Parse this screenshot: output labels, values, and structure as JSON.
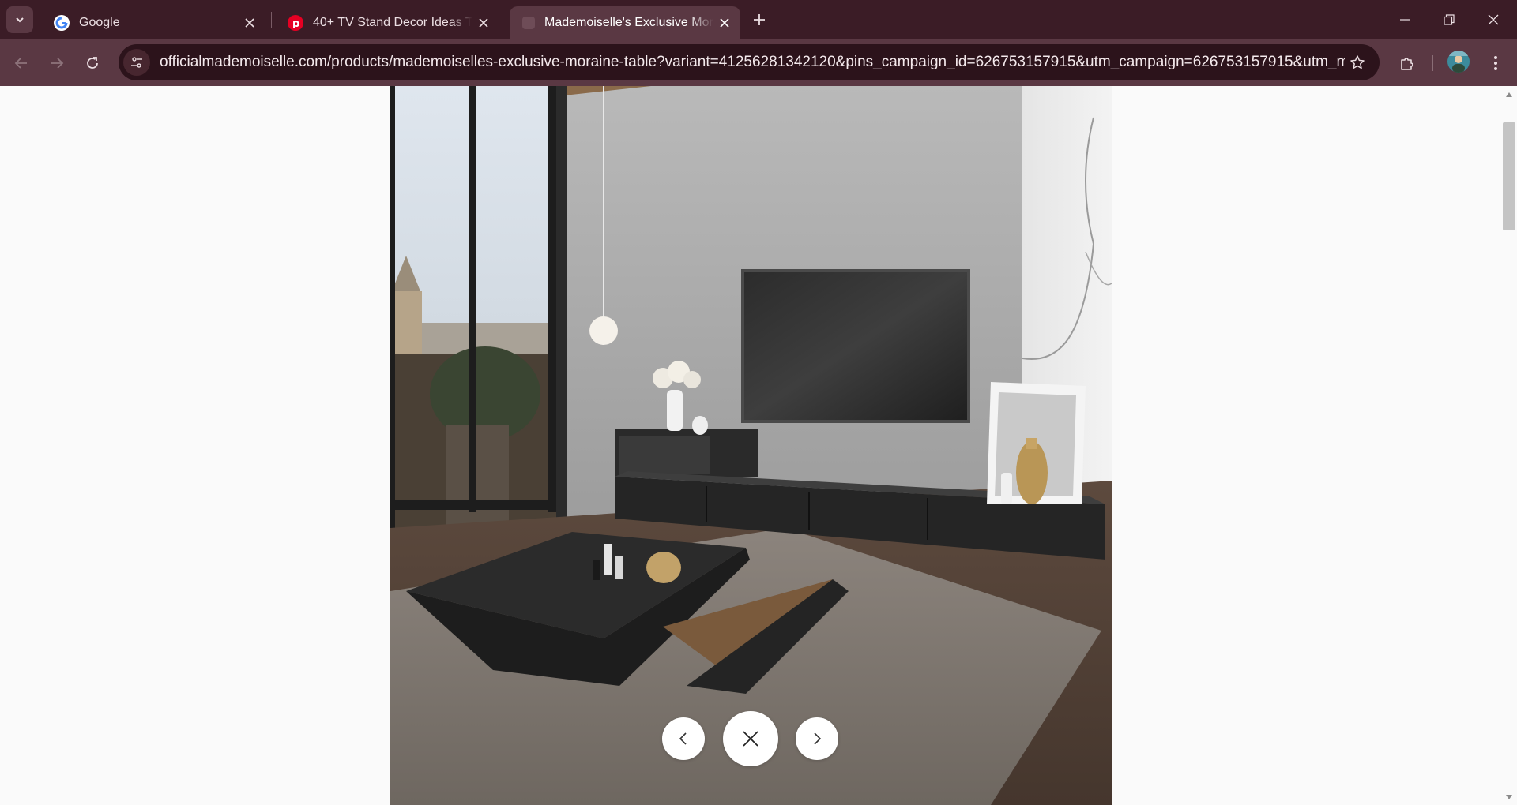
{
  "browser": {
    "tabs": [
      {
        "title": "Google",
        "favicon": "google-icon",
        "active": false
      },
      {
        "title": "40+ TV Stand Decor Ideas To Try",
        "favicon": "pinterest-icon",
        "active": false
      },
      {
        "title": "Mademoiselle's Exclusive Moraine Table",
        "favicon": "site-favicon",
        "active": true
      }
    ],
    "url": "officialmademoiselle.com/products/mademoiselles-exclusive-moraine-table?variant=41256281342120&pins_campaign_id=626753157915&utm_campaign=626753157915&utm_medium=Paid..."
  },
  "icons": {
    "tab_search": "chevron-down-icon",
    "new_tab": "plus-icon",
    "minimize": "minimize-icon",
    "restore": "restore-icon",
    "close_window": "close-icon",
    "back": "arrow-left-icon",
    "forward": "arrow-right-icon",
    "reload": "reload-icon",
    "site_info": "tune-icon",
    "bookmark": "star-icon",
    "extensions": "puzzle-icon",
    "menu": "kebab-menu-icon",
    "lightbox_prev": "chevron-left-icon",
    "lightbox_close": "close-icon",
    "lightbox_next": "chevron-right-icon"
  },
  "colors": {
    "tabstrip": "#3b1c26",
    "toolbar": "#5a3843",
    "omnibox": "#2c131b",
    "page_background": "#fafafa"
  }
}
